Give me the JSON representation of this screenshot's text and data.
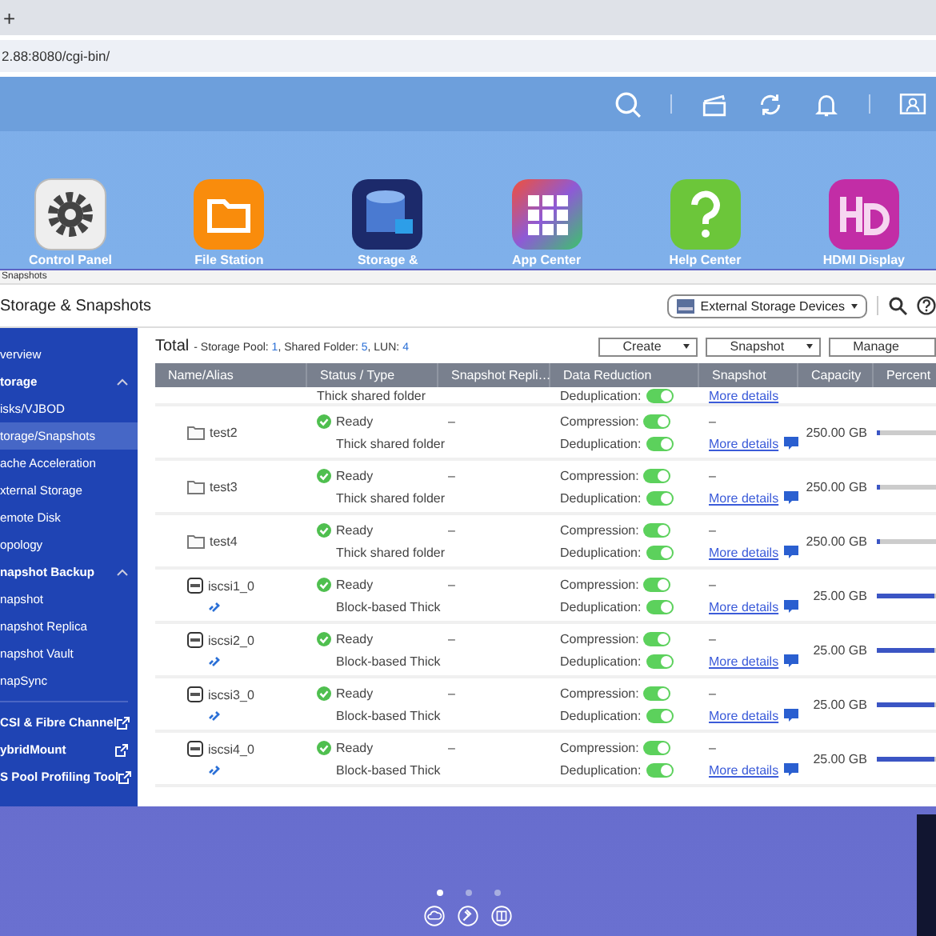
{
  "browser": {
    "new_tab": "+",
    "address": "2.88:8080/cgi-bin/"
  },
  "desktop": {
    "apps": [
      {
        "label": "Control Panel",
        "kind": "gear"
      },
      {
        "label": "File Station",
        "kind": "folder"
      },
      {
        "label": "Storage &",
        "kind": "storage"
      },
      {
        "label": "App Center",
        "kind": "apps"
      },
      {
        "label": "Help Center",
        "kind": "help"
      },
      {
        "label": "HDMI Display",
        "kind": "hd"
      }
    ],
    "page_dots": [
      {
        "selected": true
      },
      {
        "selected": false
      },
      {
        "selected": false
      }
    ]
  },
  "window": {
    "caption": "Snapshots",
    "title": "Storage & Snapshots",
    "device_dropdown": "External Storage Devices",
    "sidebar": [
      {
        "label": "verview",
        "kind": "item",
        "selected": false
      },
      {
        "label": "torage",
        "kind": "section",
        "expanded": true
      },
      {
        "label": "isks/VJBOD",
        "kind": "item",
        "selected": false
      },
      {
        "label": "torage/Snapshots",
        "kind": "item",
        "selected": true
      },
      {
        "label": "ache Acceleration",
        "kind": "item",
        "selected": false
      },
      {
        "label": "xternal Storage",
        "kind": "item",
        "selected": false
      },
      {
        "label": "emote Disk",
        "kind": "item",
        "selected": false
      },
      {
        "label": "opology",
        "kind": "item",
        "selected": false
      },
      {
        "label": "napshot Backup",
        "kind": "section",
        "expanded": true
      },
      {
        "label": "napshot",
        "kind": "item",
        "selected": false
      },
      {
        "label": "napshot Replica",
        "kind": "item",
        "selected": false
      },
      {
        "label": "napshot Vault",
        "kind": "item",
        "selected": false
      },
      {
        "label": "napSync",
        "kind": "item",
        "selected": false
      },
      {
        "label": "CSI & Fibre Channel",
        "kind": "external"
      },
      {
        "label": "ybridMount",
        "kind": "external"
      },
      {
        "label": "S Pool Profiling Tool",
        "kind": "external"
      }
    ],
    "summary": {
      "title": "Total",
      "separator": "-",
      "counts": [
        {
          "label": "Storage Pool:",
          "value": "1"
        },
        {
          "label": ", Shared Folder:",
          "value": "5"
        },
        {
          "label": ", LUN:",
          "value": "4"
        }
      ]
    },
    "buttons": [
      {
        "label": "Create",
        "dropdown": true
      },
      {
        "label": "Snapshot",
        "dropdown": true
      },
      {
        "label": "Manage",
        "dropdown": false
      }
    ],
    "table": {
      "columns": [
        "Name/Alias",
        "Status / Type",
        "Snapshot Repli…",
        "Data Reduction",
        "Snapshot",
        "Capacity",
        "Percent"
      ],
      "cut_row": {
        "type": "Thick shared folder",
        "deduplication_label": "Deduplication:",
        "deduplication": true,
        "details": "More details"
      },
      "rows": [
        {
          "name": "test2",
          "kind": "folder",
          "status": "Ready",
          "type": "Thick shared folder",
          "replica": "–",
          "compression_label": "Compression:",
          "compression": true,
          "deduplication_label": "Deduplication:",
          "deduplication": true,
          "snapshot": "–",
          "details": "More details",
          "capacity": "250.00 GB",
          "level": 0.05
        },
        {
          "name": "test3",
          "kind": "folder",
          "status": "Ready",
          "type": "Thick shared folder",
          "replica": "–",
          "compression_label": "Compression:",
          "compression": true,
          "deduplication_label": "Deduplication:",
          "deduplication": true,
          "snapshot": "–",
          "details": "More details",
          "capacity": "250.00 GB",
          "level": 0.05
        },
        {
          "name": "test4",
          "kind": "folder",
          "status": "Ready",
          "type": "Thick shared folder",
          "replica": "–",
          "compression_label": "Compression:",
          "compression": true,
          "deduplication_label": "Deduplication:",
          "deduplication": true,
          "snapshot": "–",
          "details": "More details",
          "capacity": "250.00 GB",
          "level": 0.05
        },
        {
          "name": "iscsi1_0",
          "kind": "lun",
          "status": "Ready",
          "type": "Block-based Thick",
          "replica": "–",
          "compression_label": "Compression:",
          "compression": true,
          "deduplication_label": "Deduplication:",
          "deduplication": true,
          "snapshot": "–",
          "details": "More details",
          "capacity": "25.00 GB",
          "level": 0.9
        },
        {
          "name": "iscsi2_0",
          "kind": "lun",
          "status": "Ready",
          "type": "Block-based Thick",
          "replica": "–",
          "compression_label": "Compression:",
          "compression": true,
          "deduplication_label": "Deduplication:",
          "deduplication": true,
          "snapshot": "–",
          "details": "More details",
          "capacity": "25.00 GB",
          "level": 0.9
        },
        {
          "name": "iscsi3_0",
          "kind": "lun",
          "status": "Ready",
          "type": "Block-based Thick",
          "replica": "–",
          "compression_label": "Compression:",
          "compression": true,
          "deduplication_label": "Deduplication:",
          "deduplication": true,
          "snapshot": "–",
          "details": "More details",
          "capacity": "25.00 GB",
          "level": 0.9
        },
        {
          "name": "iscsi4_0",
          "kind": "lun",
          "status": "Ready",
          "type": "Block-based Thick",
          "replica": "–",
          "compression_label": "Compression:",
          "compression": true,
          "deduplication_label": "Deduplication:",
          "deduplication": true,
          "snapshot": "–",
          "details": "More details",
          "capacity": "25.00 GB",
          "level": 0.9
        }
      ]
    }
  }
}
